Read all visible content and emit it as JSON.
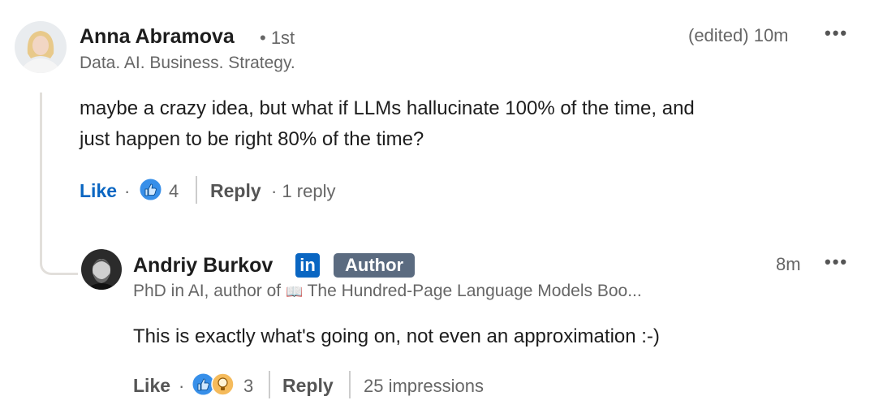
{
  "comment": {
    "author_name": "Anna Abramova",
    "degree": "• 1st",
    "headline": "Data. AI. Business. Strategy.",
    "timestamp": "(edited) 10m",
    "menu_icon": "more-horizontal-icon",
    "text_line1": "maybe a crazy idea, but what if LLMs hallucinate 100% of the time, and",
    "text_line2": "just happen to be right 80% of the time?",
    "like_label": "Like",
    "sep": "·",
    "reaction_count": "4",
    "reply_label": "Reply",
    "replies": "· 1 reply",
    "accent": "#0a66c2"
  },
  "reply": {
    "author_name": "Andriy Burkov",
    "linkedin_icon": "in",
    "badge": "Author",
    "headline": "PhD in AI, author of",
    "book_icon": "📖",
    "headline_book": "The Hundred-Page Language Models Boo...",
    "timestamp": "8m",
    "menu_icon": "more-horizontal-icon",
    "text": "This is exactly what's going on, not even an approximation :-)",
    "like_label": "Like",
    "sep": "·",
    "reaction_count": "3",
    "reply_label": "Reply",
    "impressions": "25 impressions"
  }
}
